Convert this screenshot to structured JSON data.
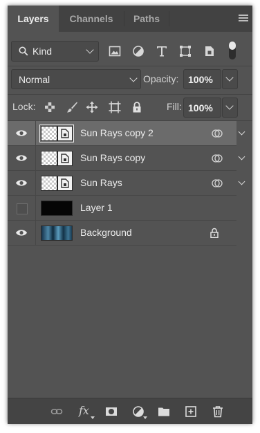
{
  "tabs": [
    {
      "label": "Layers",
      "active": true
    },
    {
      "label": "Channels",
      "active": false
    },
    {
      "label": "Paths",
      "active": false
    }
  ],
  "filter": {
    "kind_label": "Kind",
    "icons": [
      "image-filter-icon",
      "adjustment-filter-icon",
      "type-filter-icon",
      "shape-filter-icon",
      "smart-object-filter-icon"
    ]
  },
  "blend": {
    "mode": "Normal",
    "opacity_label": "Opacity:",
    "opacity_value": "100%"
  },
  "lock": {
    "label": "Lock:",
    "fill_label": "Fill:",
    "fill_value": "100%"
  },
  "layers": [
    {
      "name": "Sun Rays copy 2",
      "visible": true,
      "selected": true,
      "type": "smart",
      "has_filter": true
    },
    {
      "name": "Sun Rays copy",
      "visible": true,
      "selected": false,
      "type": "smart",
      "has_filter": true
    },
    {
      "name": "Sun Rays",
      "visible": true,
      "selected": false,
      "type": "smart",
      "has_filter": true
    },
    {
      "name": "Layer 1",
      "visible": false,
      "selected": false,
      "type": "black",
      "has_filter": false
    },
    {
      "name": "Background",
      "visible": true,
      "selected": false,
      "type": "photo",
      "locked": true
    }
  ],
  "bottom": {
    "fx_label": "fx",
    "icons": [
      "link-layers-icon",
      "layer-style-icon",
      "add-mask-icon",
      "new-adjustment-icon",
      "new-group-icon",
      "new-layer-icon",
      "delete-layer-icon"
    ]
  },
  "colors": {
    "panel": "#535353",
    "tabbar": "#424242",
    "selected_row": "#6b6b6b",
    "text": "#ececec"
  }
}
